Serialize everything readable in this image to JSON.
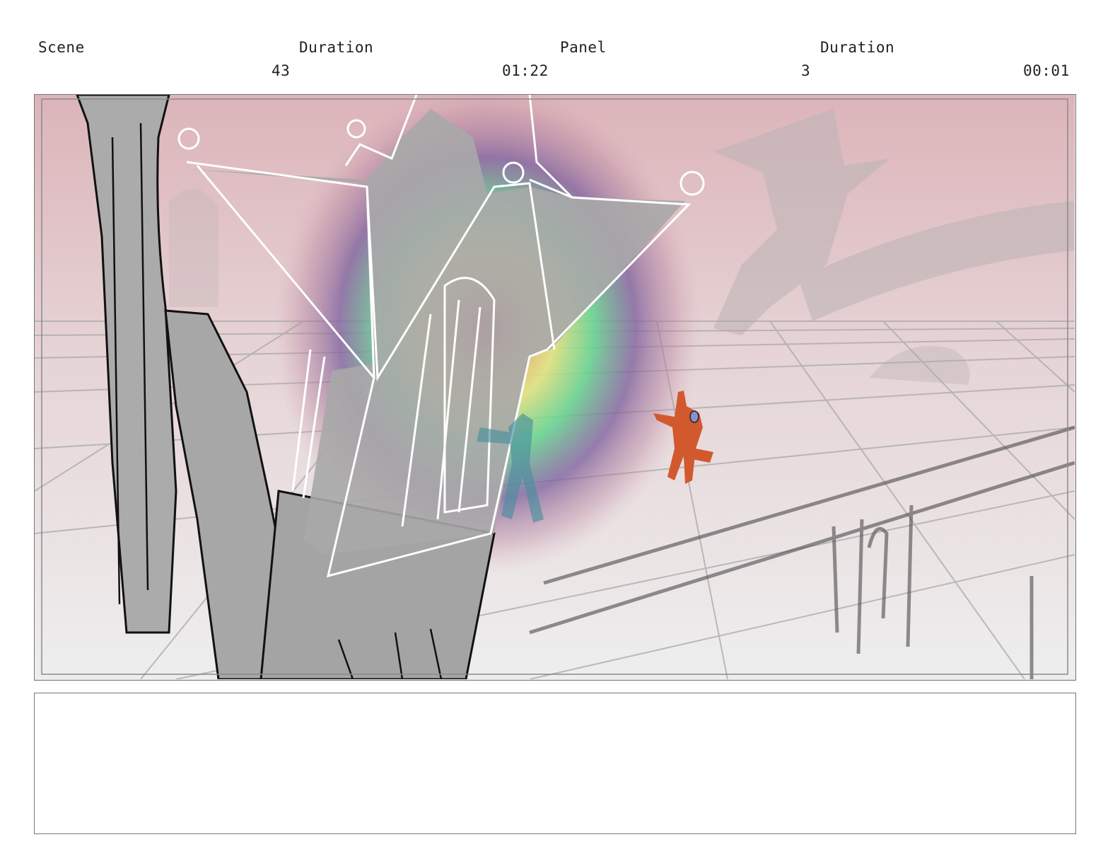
{
  "header": {
    "scene_label": "Scene",
    "scene_duration_label": "Duration",
    "panel_label": "Panel",
    "panel_duration_label": "Duration",
    "scene_value": "43",
    "scene_duration_value": "01:22",
    "panel_value": "3",
    "panel_duration_value": "00:01"
  },
  "colors": {
    "sky_top": "#d9b3b8",
    "sky_bottom": "#ece9ea",
    "structure_gray": "#a9a9a9",
    "figure_orange": "#d2582e",
    "figure_teal": "#4a8f9e",
    "heat_hot": "#d24a6a",
    "heat_mid": "#e7e07a",
    "heat_green": "#5fd08f",
    "heat_purple": "#7a5a9a"
  },
  "notes": {
    "text": ""
  }
}
